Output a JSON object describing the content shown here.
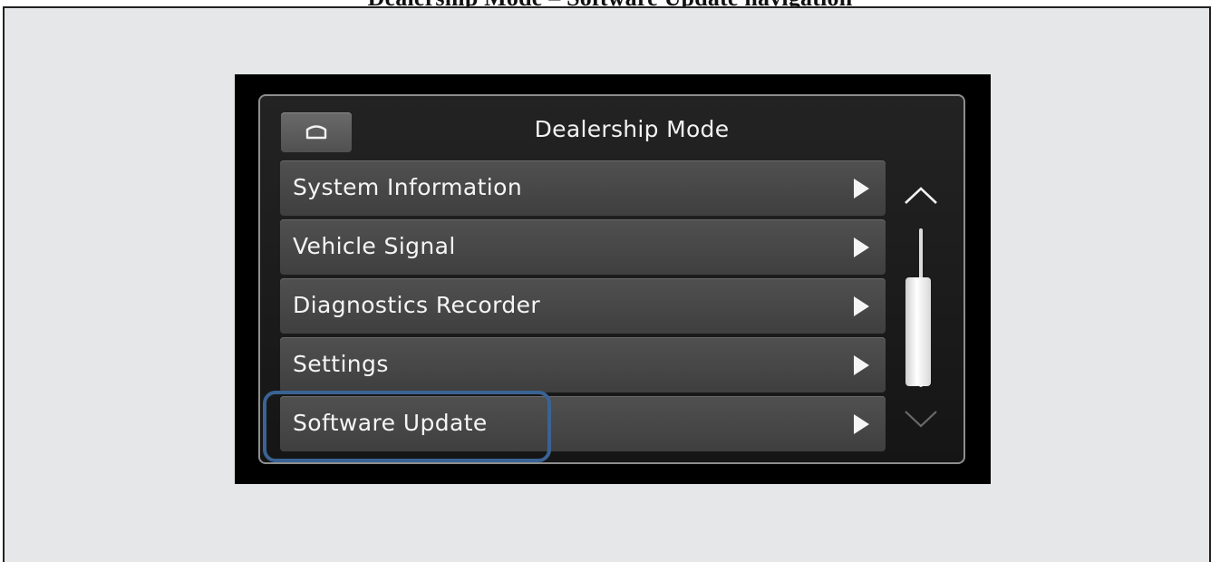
{
  "caption": "Dealership Mode – Software Update navigation",
  "screen": {
    "title": "Dealership Mode",
    "home_icon": "home-icon",
    "menu_items": [
      {
        "label": "System Information"
      },
      {
        "label": "Vehicle Signal"
      },
      {
        "label": "Diagnostics Recorder"
      },
      {
        "label": "Settings"
      },
      {
        "label": "Software Update"
      }
    ],
    "highlighted_item": "Software Update",
    "scroll": {
      "up_icon": "chevron-up-icon",
      "down_icon": "chevron-down-icon",
      "position": 0.6
    }
  },
  "colors": {
    "highlight": "#3a6394",
    "row": "#4a4a4a",
    "background": "#e6e7e8"
  }
}
